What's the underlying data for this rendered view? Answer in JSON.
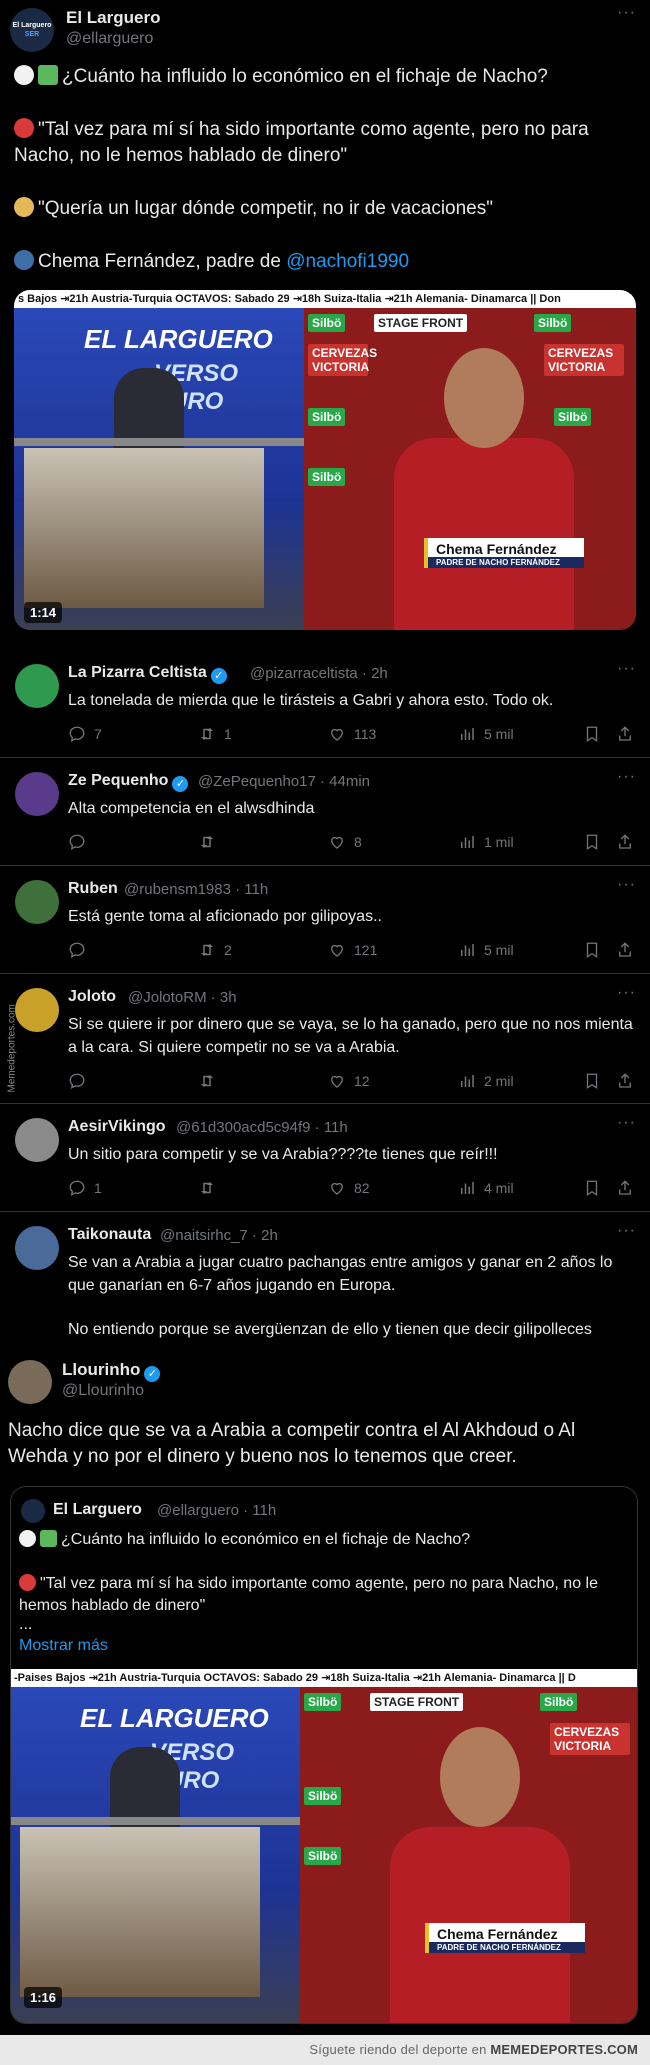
{
  "main_tweet": {
    "name": "El Larguero",
    "handle": "@ellarguero",
    "avatar_label_top": "El Larguero",
    "avatar_label_bottom": "SER",
    "lines": [
      "¿Cuánto ha influido lo económico en el fichaje de Nacho?",
      "\"Tal vez para mí sí ha sido importante como agente, pero no para Nacho, no le hemos hablado de dinero\"",
      "\"Quería un lugar dónde competir, no ir de vacaciones\"",
      "Chema Fernández, padre de"
    ],
    "mention": "@nachofi1990",
    "video": {
      "ticker": "s Bajos ⇥21h Austria-Turquia OCTAVOS: Sabado 29 ⇥18h Suiza-Italia ⇥21h Alemania- Dinamarca || Don",
      "studio_title": "EL LARGUERO",
      "studio_sub": "VERSO EURO",
      "sponsor_1": "Silbö",
      "sponsor_2": "STAGE FRONT",
      "sponsor_3": "CERVEZAS VICTORIA",
      "lower_third_name": "Chema Fernández",
      "lower_third_role": "PADRE DE NACHO FERNÁNDEZ",
      "duration": "1:14"
    }
  },
  "replies": [
    {
      "name": "La Pizarra Celtista",
      "verified": true,
      "handle": "@pizarraceltista · 2h",
      "text": "La tonelada de mierda que le tirásteis a Gabri y ahora esto. Todo ok.",
      "replies": "7",
      "reposts": "1",
      "likes": "113",
      "views": "5 mil",
      "avatar_color": "#2f9a4f"
    },
    {
      "name": "Ze Pequenho",
      "verified": true,
      "handle": "@ZePequenho17 · 44min",
      "text": "Alta competencia en el alwsdhinda",
      "replies": "",
      "reposts": "",
      "likes": "8",
      "views": "1 mil",
      "avatar_color": "#5a3a8a"
    },
    {
      "name": "Ruben",
      "verified": false,
      "handle": "@rubensm1983 · 11h",
      "text": "Está gente toma al aficionado por gilipoyas..",
      "replies": "",
      "reposts": "2",
      "likes": "121",
      "views": "5 mil",
      "avatar_color": "#3f6f3a"
    },
    {
      "name": "Joloto",
      "verified": false,
      "handle": "@JolotoRM · 3h",
      "text": "Si se quiere ir por dinero que se vaya, se lo ha ganado, pero que no nos mienta a la cara. Si quiere competir no se va a Arabia.",
      "replies": "",
      "reposts": "",
      "likes": "12",
      "views": "2 mil",
      "avatar_color": "#c9a02a"
    },
    {
      "name": "AesirVikingo",
      "verified": false,
      "handle": "@61d300acd5c94f9 · 11h",
      "text": "Un sitio para competir y se va Arabia????te tienes que reír!!!",
      "replies": "1",
      "reposts": "",
      "likes": "82",
      "views": "4 mil",
      "avatar_color": "#8a8a8a"
    },
    {
      "name": "Taikonauta",
      "verified": false,
      "handle": "@naitsirhc_7 · 2h",
      "text": "Se van a Arabia a jugar cuatro pachangas entre amigos y ganar en 2  años lo que ganarían en 6-7 años jugando en Europa.",
      "text2": "No entiendo porque se avergüenzan de ello y tienen que decir gilipolleces",
      "avatar_color": "#4a6a9a"
    }
  ],
  "watermark_side": "Memedeportes.com",
  "quote_tweet": {
    "name": "Llourinho",
    "verified": true,
    "handle": "@Llourinho",
    "text": "Nacho dice que se va a Arabia a competir contra el Al Akhdoud o Al Wehda y no por el dinero y bueno nos lo tenemos que creer.",
    "quoted": {
      "name": "El Larguero",
      "handle": "@ellarguero · 11h",
      "line1": "¿Cuánto ha influido lo económico en el fichaje de Nacho?",
      "line2": "\"Tal vez para mí sí ha sido importante como agente, pero no para Nacho, no le hemos hablado de dinero\"",
      "ellipsis": "...",
      "show_more": "Mostrar más",
      "video": {
        "ticker": "-Paises Bajos ⇥21h Austria-Turquia OCTAVOS: Sabado 29 ⇥18h Suiza-Italia ⇥21h Alemania- Dinamarca || D",
        "studio_title": "EL LARGUERO",
        "studio_sub": "VERSO EURO",
        "lower_third_name": "Chema Fernández",
        "lower_third_role": "PADRE DE NACHO FERNÁNDEZ",
        "duration": "1:16"
      }
    }
  },
  "footer": {
    "prefix": "Síguete riendo del deporte en",
    "site": "MEMEDEPORTES.COM"
  },
  "icons": {
    "eyes": "eyes-icon",
    "money": "money-icon",
    "no_entry": "no-entry-icon",
    "beach": "beach-icon",
    "speaking": "speaking-head-icon"
  }
}
